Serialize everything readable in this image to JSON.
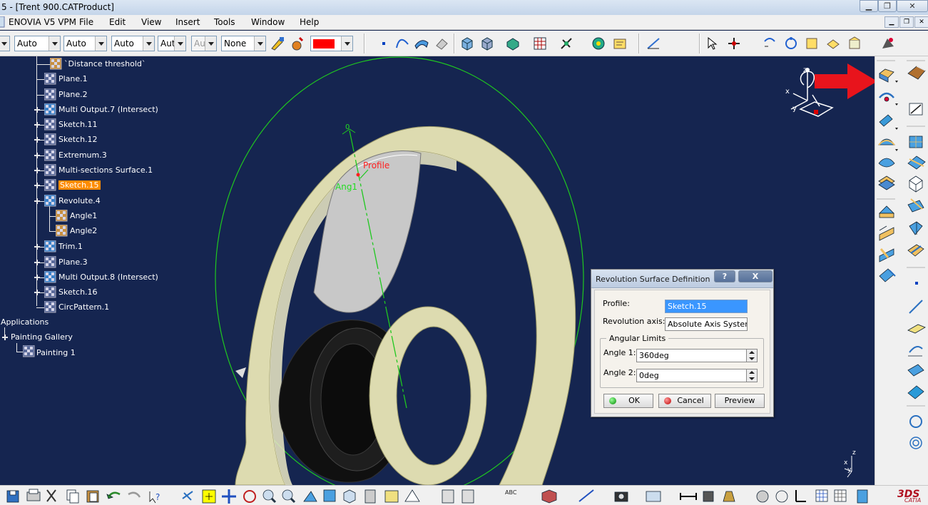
{
  "window": {
    "title": "5 - [Trent 900.CATProduct]"
  },
  "menu": {
    "items": [
      "ENOVIA V5 VPM",
      "File",
      "Edit",
      "View",
      "Insert",
      "Tools",
      "Window",
      "Help"
    ]
  },
  "toolbar": {
    "combos": [
      "",
      "Auto",
      "Auto",
      "Auto",
      "Aut",
      "Aut",
      "None"
    ],
    "color": "#ff0000"
  },
  "tree": {
    "items": [
      {
        "label": "`Distance threshold`",
        "icon": "param-icon",
        "selected": false
      },
      {
        "label": "Plane.1",
        "icon": "plane-icon",
        "selected": false
      },
      {
        "label": "Plane.2",
        "icon": "plane-icon",
        "selected": false
      },
      {
        "label": "Multi Output.7 (Intersect)",
        "icon": "multi-output-icon",
        "selected": false
      },
      {
        "label": "Sketch.11",
        "icon": "sketch-icon",
        "selected": false
      },
      {
        "label": "Sketch.12",
        "icon": "sketch-icon",
        "selected": false
      },
      {
        "label": "Extremum.3",
        "icon": "extremum-icon",
        "selected": false
      },
      {
        "label": "Multi-sections Surface.1",
        "icon": "surface-icon",
        "selected": false
      },
      {
        "label": "Sketch.15",
        "icon": "sketch-icon",
        "selected": true
      },
      {
        "label": "Revolute.4",
        "icon": "revolute-icon",
        "selected": false
      },
      {
        "label": "Angle1",
        "icon": "param-icon",
        "selected": false
      },
      {
        "label": "Angle2",
        "icon": "param-icon",
        "selected": false
      },
      {
        "label": "Trim.1",
        "icon": "trim-icon",
        "selected": false
      },
      {
        "label": "Plane.3",
        "icon": "plane-icon",
        "selected": false
      },
      {
        "label": "Multi Output.8 (Intersect)",
        "icon": "multi-output-icon",
        "selected": false
      },
      {
        "label": "Sketch.16",
        "icon": "sketch-icon",
        "selected": false
      },
      {
        "label": "CircPattern.1",
        "icon": "pattern-icon",
        "selected": false
      }
    ],
    "applications": "Applications",
    "painting_gallery": "Painting Gallery",
    "painting": "Painting 1"
  },
  "viewport": {
    "annotations": {
      "profile": "Profile",
      "angle": "Ang1",
      "angle_value": "0"
    },
    "compass": {
      "x": "x",
      "y": "y",
      "z": "z"
    },
    "axis_triad": {
      "x": "x",
      "y": "y",
      "z": "z"
    }
  },
  "dialog": {
    "title": "Revolution Surface Definition",
    "help_button": "?",
    "close_button": "X",
    "profile_label": "Profile:",
    "profile_value": "Sketch.15",
    "axis_label": "Revolution axis:",
    "axis_value": "Absolute Axis System",
    "group_label": "Angular Limits",
    "angle1_label": "Angle 1:",
    "angle1_value": "360deg",
    "angle2_label": "Angle 2:",
    "angle2_value": "0deg",
    "ok_label": "OK",
    "cancel_label": "Cancel",
    "preview_label": "Preview"
  },
  "statusbar": {
    "text_icon": "ABC"
  },
  "brand": {
    "logo_text": "CATIA"
  }
}
